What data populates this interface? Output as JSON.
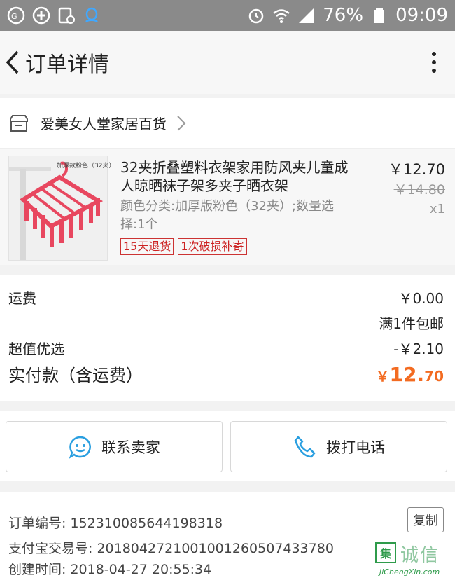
{
  "status_bar": {
    "battery": "76%",
    "time": "09:09",
    "left_icons": [
      "vpn-key-icon",
      "add-circle-icon",
      "image-clock-icon",
      "qq-penguin-icon"
    ],
    "right_icons": [
      "alarm-icon",
      "wifi-icon",
      "signal-icon",
      "battery-icon"
    ]
  },
  "header": {
    "title": "订单详情"
  },
  "shop": {
    "name": "爱美女人堂家居百货"
  },
  "product": {
    "image_label": "加厚款粉色（32夹）",
    "title": "32夹折叠塑料衣架家用防风夹儿童成人晾晒袜子架多夹子晒衣架",
    "spec": "颜色分类:加厚版粉色（32夹）;数量选择:1个",
    "price": "￥12.70",
    "original_price": "￥14.80",
    "quantity": "x1",
    "tags": [
      "15天退货",
      "1次破损补寄"
    ],
    "image_color": "#e8475f"
  },
  "costs": {
    "shipping_label": "运费",
    "shipping_value": "￥0.00",
    "shipping_note": "满1件包邮",
    "discount_label": "超值优选",
    "discount_value": "-￥2.10",
    "total_label": "实付款（含运费）",
    "total_currency": "￥",
    "total_int": "12.",
    "total_dec": "70",
    "total_color": "#f36b21"
  },
  "contact": {
    "seller_label": "联系卖家",
    "call_label": "拨打电话",
    "icon_color": "#2a9fe0"
  },
  "order": {
    "number_line": "订单编号: 152310085644198318",
    "alipay_line": "支付宝交易号: 2018042721001001260507433780",
    "created_line": "创建时间: 2018-04-27 20:55:34",
    "copy_label": "复制"
  },
  "watermark": {
    "logo_char": "集",
    "text": "诚信",
    "url": "JiChengXin.com"
  }
}
